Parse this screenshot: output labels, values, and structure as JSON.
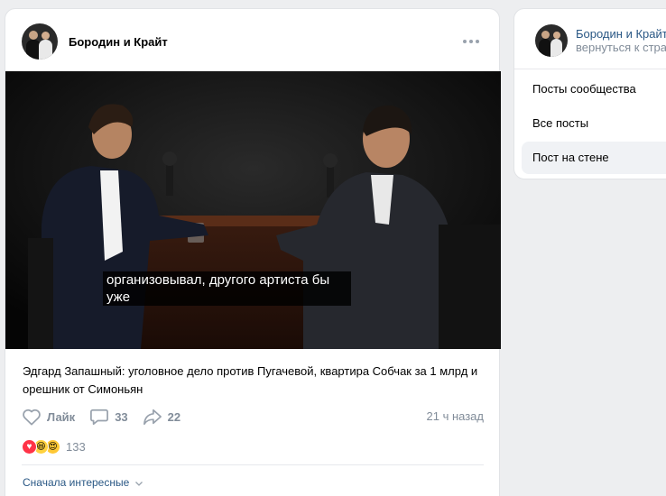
{
  "post": {
    "author": "Бородин и Крайт",
    "video": {
      "subtitle_line1": "организовывал, другого артиста бы",
      "subtitle_line2": "уже"
    },
    "text": "Эдгард Запашный: уголовное дело против Пугачевой, квартира Собчак за 1 млрд и орешник от Симоньян",
    "actions": {
      "like_label": "Лайк",
      "comments_count": "33",
      "shares_count": "22"
    },
    "timestamp": "21 ч назад",
    "reactions": {
      "icons": [
        "heart-icon",
        "laughing-emoji-icon",
        "heart-eyes-emoji-icon"
      ],
      "count": "133"
    },
    "comments_sort": "Сначала интересные"
  },
  "sidebar": {
    "community_name": "Бородин и Крайт",
    "back_link": "вернуться к стра",
    "items": [
      {
        "label": "Посты сообщества"
      },
      {
        "label": "Все посты"
      },
      {
        "label": "Пост на стене",
        "selected": true
      }
    ]
  },
  "colors": {
    "page_bg": "#edeef0",
    "link": "#2a5885",
    "secondary_text": "#818c99",
    "reaction_heart": "#ff3347"
  }
}
